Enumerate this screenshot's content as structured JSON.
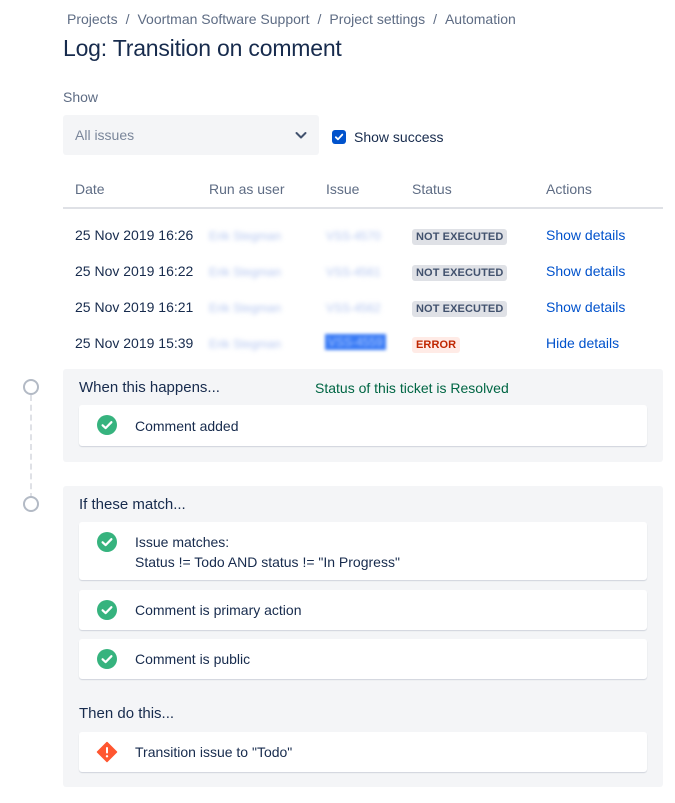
{
  "breadcrumb": [
    "Projects",
    "Voortman Software Support",
    "Project settings",
    "Automation"
  ],
  "page_title": "Log: Transition on comment",
  "filter": {
    "show_label": "Show",
    "select_value": "All issues",
    "checkbox_label": "Show success",
    "checkbox_checked": true
  },
  "table": {
    "headers": [
      "Date",
      "Run as user",
      "Issue",
      "Status",
      "Actions"
    ],
    "rows": [
      {
        "date": "25 Nov 2019 16:26",
        "user": "Erik Stegman",
        "issue": "VSS-4570",
        "status": "NOT EXECUTED",
        "action": "Show details"
      },
      {
        "date": "25 Nov 2019 16:22",
        "user": "Erik Stegman",
        "issue": "VSS-4561",
        "status": "NOT EXECUTED",
        "action": "Show details"
      },
      {
        "date": "25 Nov 2019 16:21",
        "user": "Erik Stegman",
        "issue": "VSS-4562",
        "status": "NOT EXECUTED",
        "action": "Show details"
      },
      {
        "date": "25 Nov 2019 15:39",
        "user": "Erik Stegman",
        "issue": "VSS-4559",
        "status": "ERROR",
        "action": "Hide details"
      }
    ]
  },
  "details": {
    "trigger": {
      "title": "When this happens...",
      "note": "Status of this ticket is Resolved",
      "items": [
        {
          "icon": "check-circle-icon",
          "text": "Comment added"
        }
      ]
    },
    "conditions": {
      "title": "If these match...",
      "items": [
        {
          "icon": "check-circle-icon",
          "line1": "Issue matches:",
          "line2": "Status != Todo AND status != \"In Progress\""
        },
        {
          "icon": "check-circle-icon",
          "text": "Comment is primary action"
        },
        {
          "icon": "check-circle-icon",
          "text": "Comment is public"
        }
      ]
    },
    "actions": {
      "title": "Then do this...",
      "items": [
        {
          "icon": "error-diamond-icon",
          "text": "Transition issue to \"Todo\""
        }
      ]
    }
  },
  "colors": {
    "accent": "#0052cc",
    "success": "#36b37e",
    "error": "#ff5630",
    "note": "#006644"
  }
}
